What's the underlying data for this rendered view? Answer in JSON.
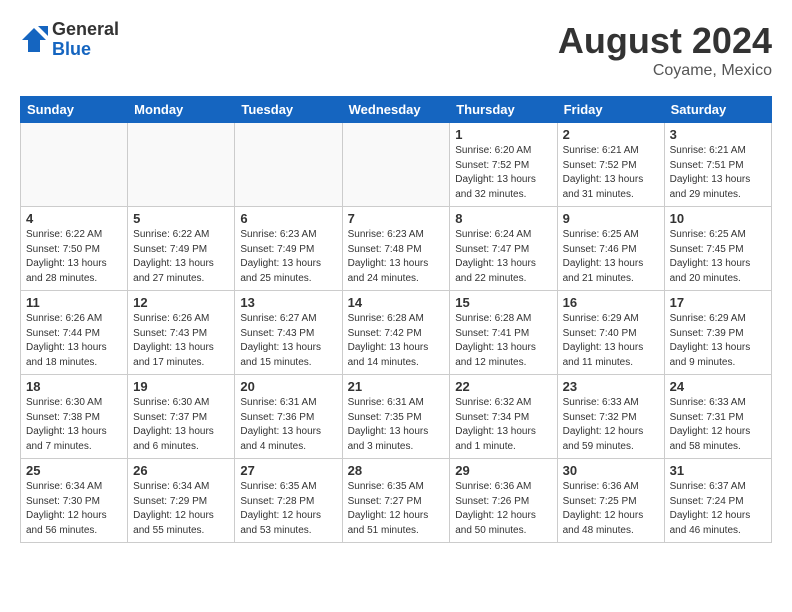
{
  "header": {
    "logo_general": "General",
    "logo_blue": "Blue",
    "month_year": "August 2024",
    "location": "Coyame, Mexico"
  },
  "weekdays": [
    "Sunday",
    "Monday",
    "Tuesday",
    "Wednesday",
    "Thursday",
    "Friday",
    "Saturday"
  ],
  "weeks": [
    [
      {
        "day": "",
        "info": ""
      },
      {
        "day": "",
        "info": ""
      },
      {
        "day": "",
        "info": ""
      },
      {
        "day": "",
        "info": ""
      },
      {
        "day": "1",
        "info": "Sunrise: 6:20 AM\nSunset: 7:52 PM\nDaylight: 13 hours\nand 32 minutes."
      },
      {
        "day": "2",
        "info": "Sunrise: 6:21 AM\nSunset: 7:52 PM\nDaylight: 13 hours\nand 31 minutes."
      },
      {
        "day": "3",
        "info": "Sunrise: 6:21 AM\nSunset: 7:51 PM\nDaylight: 13 hours\nand 29 minutes."
      }
    ],
    [
      {
        "day": "4",
        "info": "Sunrise: 6:22 AM\nSunset: 7:50 PM\nDaylight: 13 hours\nand 28 minutes."
      },
      {
        "day": "5",
        "info": "Sunrise: 6:22 AM\nSunset: 7:49 PM\nDaylight: 13 hours\nand 27 minutes."
      },
      {
        "day": "6",
        "info": "Sunrise: 6:23 AM\nSunset: 7:49 PM\nDaylight: 13 hours\nand 25 minutes."
      },
      {
        "day": "7",
        "info": "Sunrise: 6:23 AM\nSunset: 7:48 PM\nDaylight: 13 hours\nand 24 minutes."
      },
      {
        "day": "8",
        "info": "Sunrise: 6:24 AM\nSunset: 7:47 PM\nDaylight: 13 hours\nand 22 minutes."
      },
      {
        "day": "9",
        "info": "Sunrise: 6:25 AM\nSunset: 7:46 PM\nDaylight: 13 hours\nand 21 minutes."
      },
      {
        "day": "10",
        "info": "Sunrise: 6:25 AM\nSunset: 7:45 PM\nDaylight: 13 hours\nand 20 minutes."
      }
    ],
    [
      {
        "day": "11",
        "info": "Sunrise: 6:26 AM\nSunset: 7:44 PM\nDaylight: 13 hours\nand 18 minutes."
      },
      {
        "day": "12",
        "info": "Sunrise: 6:26 AM\nSunset: 7:43 PM\nDaylight: 13 hours\nand 17 minutes."
      },
      {
        "day": "13",
        "info": "Sunrise: 6:27 AM\nSunset: 7:43 PM\nDaylight: 13 hours\nand 15 minutes."
      },
      {
        "day": "14",
        "info": "Sunrise: 6:28 AM\nSunset: 7:42 PM\nDaylight: 13 hours\nand 14 minutes."
      },
      {
        "day": "15",
        "info": "Sunrise: 6:28 AM\nSunset: 7:41 PM\nDaylight: 13 hours\nand 12 minutes."
      },
      {
        "day": "16",
        "info": "Sunrise: 6:29 AM\nSunset: 7:40 PM\nDaylight: 13 hours\nand 11 minutes."
      },
      {
        "day": "17",
        "info": "Sunrise: 6:29 AM\nSunset: 7:39 PM\nDaylight: 13 hours\nand 9 minutes."
      }
    ],
    [
      {
        "day": "18",
        "info": "Sunrise: 6:30 AM\nSunset: 7:38 PM\nDaylight: 13 hours\nand 7 minutes."
      },
      {
        "day": "19",
        "info": "Sunrise: 6:30 AM\nSunset: 7:37 PM\nDaylight: 13 hours\nand 6 minutes."
      },
      {
        "day": "20",
        "info": "Sunrise: 6:31 AM\nSunset: 7:36 PM\nDaylight: 13 hours\nand 4 minutes."
      },
      {
        "day": "21",
        "info": "Sunrise: 6:31 AM\nSunset: 7:35 PM\nDaylight: 13 hours\nand 3 minutes."
      },
      {
        "day": "22",
        "info": "Sunrise: 6:32 AM\nSunset: 7:34 PM\nDaylight: 13 hours\nand 1 minute."
      },
      {
        "day": "23",
        "info": "Sunrise: 6:33 AM\nSunset: 7:32 PM\nDaylight: 12 hours\nand 59 minutes."
      },
      {
        "day": "24",
        "info": "Sunrise: 6:33 AM\nSunset: 7:31 PM\nDaylight: 12 hours\nand 58 minutes."
      }
    ],
    [
      {
        "day": "25",
        "info": "Sunrise: 6:34 AM\nSunset: 7:30 PM\nDaylight: 12 hours\nand 56 minutes."
      },
      {
        "day": "26",
        "info": "Sunrise: 6:34 AM\nSunset: 7:29 PM\nDaylight: 12 hours\nand 55 minutes."
      },
      {
        "day": "27",
        "info": "Sunrise: 6:35 AM\nSunset: 7:28 PM\nDaylight: 12 hours\nand 53 minutes."
      },
      {
        "day": "28",
        "info": "Sunrise: 6:35 AM\nSunset: 7:27 PM\nDaylight: 12 hours\nand 51 minutes."
      },
      {
        "day": "29",
        "info": "Sunrise: 6:36 AM\nSunset: 7:26 PM\nDaylight: 12 hours\nand 50 minutes."
      },
      {
        "day": "30",
        "info": "Sunrise: 6:36 AM\nSunset: 7:25 PM\nDaylight: 12 hours\nand 48 minutes."
      },
      {
        "day": "31",
        "info": "Sunrise: 6:37 AM\nSunset: 7:24 PM\nDaylight: 12 hours\nand 46 minutes."
      }
    ]
  ]
}
